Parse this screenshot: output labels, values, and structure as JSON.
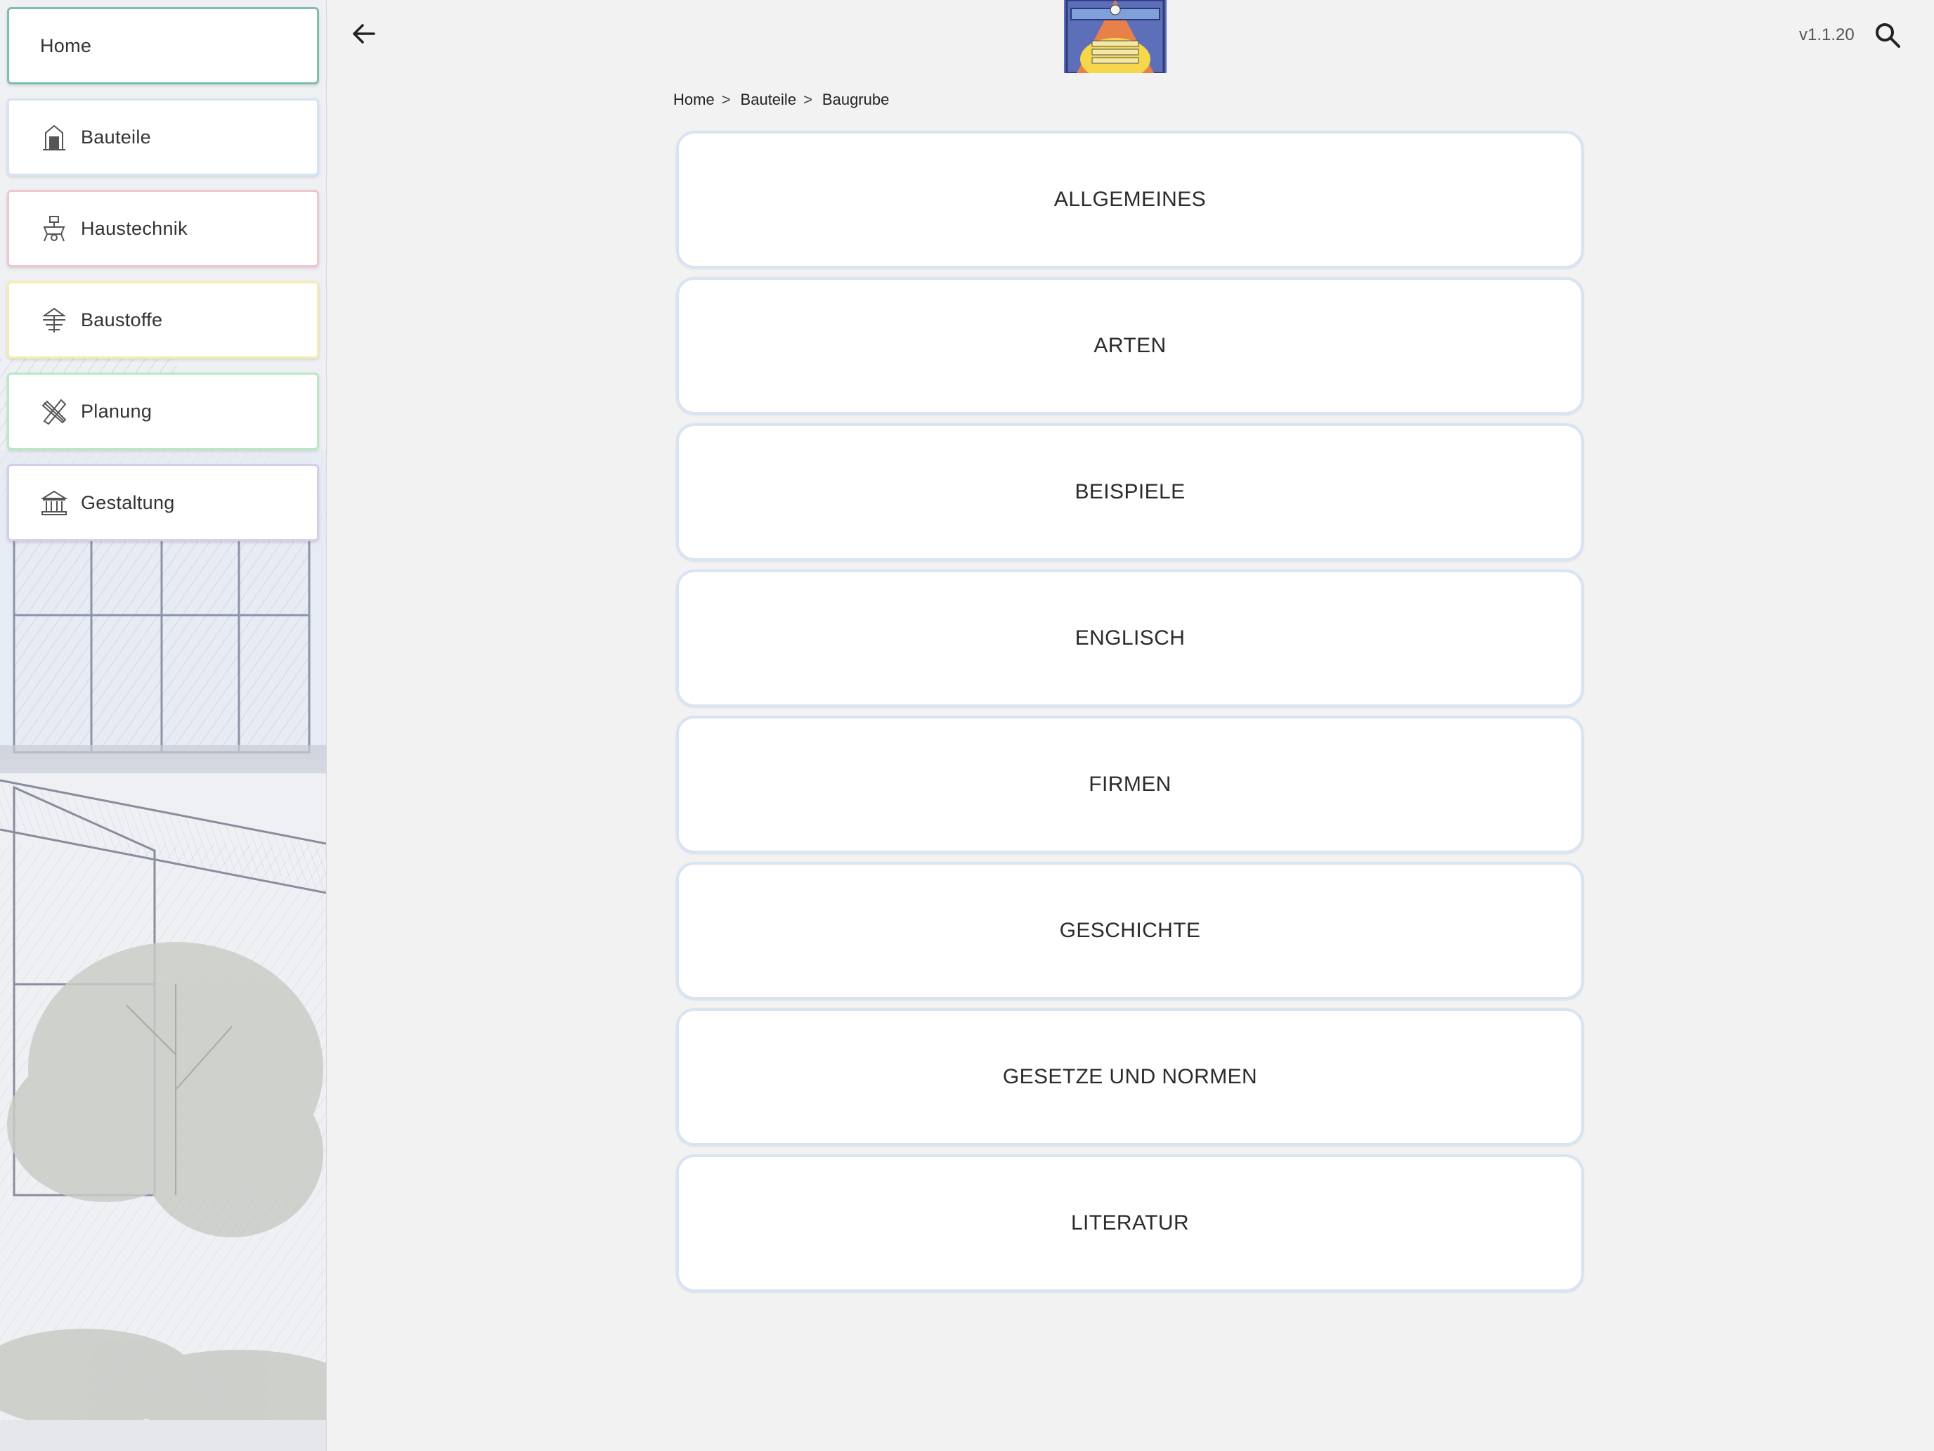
{
  "sidebar": {
    "items": [
      {
        "label": "Home",
        "icon": "home-none"
      },
      {
        "label": "Bauteile",
        "icon": "building-component-icon"
      },
      {
        "label": "Haustechnik",
        "icon": "building-services-icon"
      },
      {
        "label": "Baustoffe",
        "icon": "building-materials-icon"
      },
      {
        "label": "Planung",
        "icon": "drafting-tools-icon"
      },
      {
        "label": "Gestaltung",
        "icon": "classical-building-icon"
      }
    ]
  },
  "header": {
    "back_icon": "arrow-left-icon",
    "version": "v1.1.20",
    "search_icon": "search-icon",
    "logo_icon": "app-logo"
  },
  "breadcrumb": {
    "items": [
      "Home",
      "Bauteile",
      "Baugrube"
    ],
    "separator": ">"
  },
  "cards": [
    {
      "label": "ALLGEMEINES"
    },
    {
      "label": "ARTEN"
    },
    {
      "label": "BEISPIELE"
    },
    {
      "label": "ENGLISCH"
    },
    {
      "label": "FIRMEN"
    },
    {
      "label": "GESCHICHTE"
    },
    {
      "label": "GESETZE UND NORMEN"
    },
    {
      "label": "LITERATUR"
    }
  ],
  "colors": {
    "home_border": "#7fbfae",
    "bauteile_border": "#d5e3f3",
    "haustechnik_border": "#f0c6cc",
    "baustoffe_border": "#f4eeaa",
    "planung_border": "#b9e8c4",
    "gestaltung_border": "#d7cde9",
    "card_border": "#d9e4f2",
    "background": "#f2f2f2"
  }
}
